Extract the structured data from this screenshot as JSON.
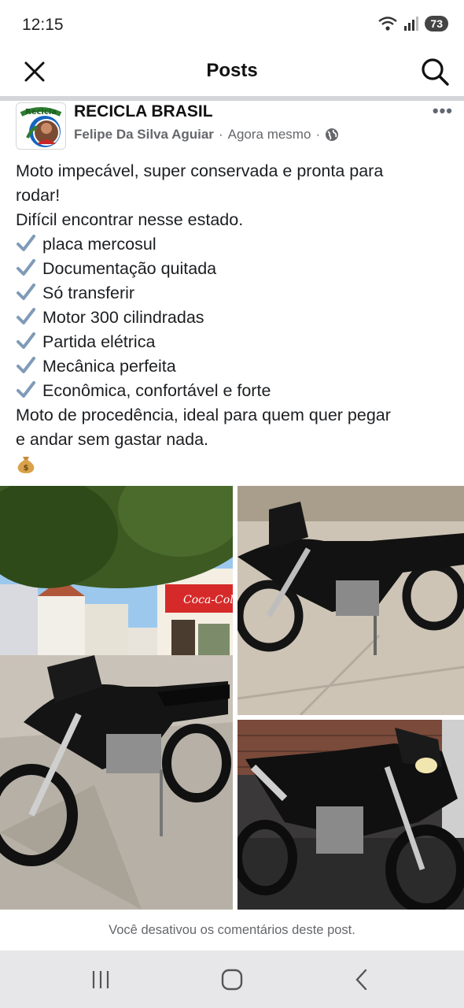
{
  "status_bar": {
    "time": "12:15",
    "battery": "73",
    "icons": [
      "wifi-icon",
      "signal-icon",
      "battery-icon"
    ]
  },
  "header": {
    "title": "Posts",
    "close_icon": "close-icon",
    "search_icon": "search-icon"
  },
  "post": {
    "group_name": "RECICLA BRASIL",
    "avatar_text": "Recicla",
    "author": "Felipe Da Silva Aguiar",
    "separator": "·",
    "time": "Agora mesmo",
    "privacy_icon": "globe-icon",
    "more_label": "•••",
    "body": {
      "line1": "Moto impecável, super conservada e pronta para",
      "line2": "rodar!",
      "line3": "Difícil encontrar nesse estado.",
      "checklist": [
        "placa mercosul",
        "Documentação quitada",
        "Só transferir",
        "Motor 300 cilindradas",
        "Partida elétrica",
        "Mecânica perfeita",
        "Econômica, confortável e forte"
      ],
      "line4": "Moto de procedência, ideal para quem quer pegar",
      "line5": "e andar sem gastar nada.",
      "emoji": "money-bag-icon"
    },
    "photos": [
      {
        "name": "motorcycle-street-photo",
        "shop_sign": "Coca-Cola"
      },
      {
        "name": "motorcycle-side-photo"
      },
      {
        "name": "motorcycle-front-photo"
      }
    ],
    "comments_disabled": "Você desativou os comentários deste post."
  },
  "nav_bar": {
    "buttons": [
      "recents-icon",
      "home-icon",
      "back-icon"
    ]
  },
  "colors": {
    "accent": "#1877f2",
    "meta_text": "#65676b",
    "nav_bg": "#e7e7ea",
    "check_blue": "#7f9bb8"
  }
}
